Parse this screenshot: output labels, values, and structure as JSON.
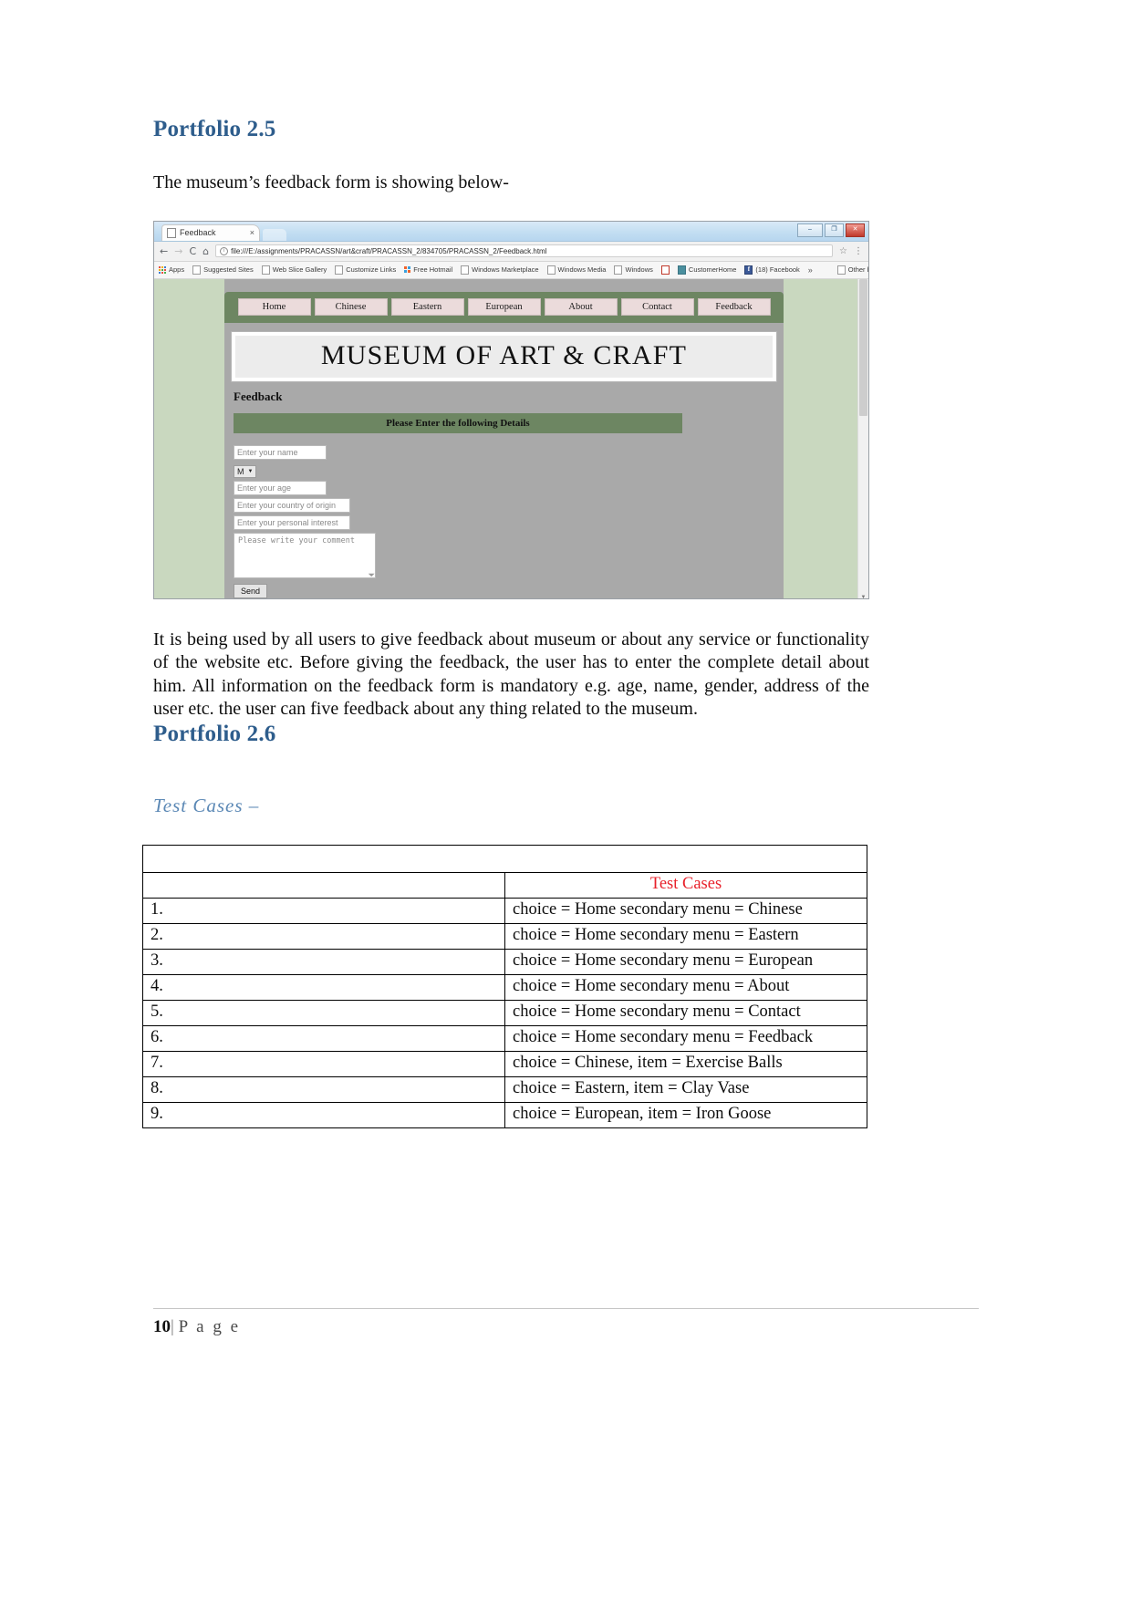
{
  "document": {
    "section_2_5": {
      "heading": "Portfolio 2.5",
      "intro": "The museum’s feedback form is showing below-",
      "description": "It is being used by all users to give feedback about museum or about any service or functionality of the website etc. Before giving the feedback, the user has to enter the complete detail about him. All information on the feedback form is mandatory e.g. age, name, gender, address of the user etc. the user can five feedback about any thing related to the museum."
    },
    "section_2_6": {
      "heading": "Portfolio 2.6",
      "subheading": "Test Cases –"
    },
    "footer": {
      "page_number": "10",
      "separator": "|",
      "word": "P a g e"
    }
  },
  "browser": {
    "tab": {
      "title": "Feedback",
      "close_label": "×"
    },
    "window_controls": {
      "minimize": "–",
      "restore": "❐",
      "close": "✕"
    },
    "toolbar": {
      "back": "←",
      "forward": "→",
      "reload": "C",
      "home": "⌂",
      "url": "file:///E:/assignments/PRACASSN/art&craft/PRACASSN_2/834705/PRACASSN_2/Feedback.html",
      "info_glyph": "i",
      "star": "☆",
      "menu": "⋮"
    },
    "bookmarks": [
      {
        "label": "Apps",
        "icon": "apps-grid-icon"
      },
      {
        "label": "Suggested Sites",
        "icon": "page-icon"
      },
      {
        "label": "Web Slice Gallery",
        "icon": "page-icon"
      },
      {
        "label": "Customize Links",
        "icon": "page-icon"
      },
      {
        "label": "Free Hotmail",
        "icon": "windows-logo-icon"
      },
      {
        "label": "Windows Marketplace",
        "icon": "page-icon"
      },
      {
        "label": "Windows Media",
        "icon": "page-icon"
      },
      {
        "label": "Windows",
        "icon": "page-icon"
      },
      {
        "label": "",
        "icon": "red-bookmark-icon"
      },
      {
        "label": "CustomerHome",
        "icon": "teal-icon"
      },
      {
        "label": "(18) Facebook",
        "icon": "facebook-icon"
      }
    ],
    "bookmarks_overflow": "»",
    "other_bookmarks": "Other bookmarks"
  },
  "site": {
    "nav": [
      "Home",
      "Chinese",
      "Eastern",
      "European",
      "About",
      "Contact",
      "Feedback"
    ],
    "banner": "MUSEUM OF ART & CRAFT",
    "page_heading": "Feedback",
    "details_bar": "Please Enter the following Details",
    "form": {
      "name_placeholder": "Enter your name",
      "gender_value": "M",
      "gender_caret": "▼",
      "age_placeholder": "Enter your age",
      "country_placeholder": "Enter your country of origin",
      "interest_placeholder": "Enter your personal interest",
      "comment_placeholder": "Please write your comment",
      "send_label": "Send"
    }
  },
  "test_cases": {
    "header": "Test Cases",
    "rows": [
      {
        "no": "1.",
        "text": "choice = Home secondary menu = Chinese"
      },
      {
        "no": "2.",
        "text": "choice = Home secondary menu = Eastern"
      },
      {
        "no": "3.",
        "text": "choice = Home secondary menu = European"
      },
      {
        "no": "4.",
        "text": "choice = Home secondary menu = About"
      },
      {
        "no": "5.",
        "text": "choice = Home secondary menu = Contact"
      },
      {
        "no": "6.",
        "text": "choice = Home secondary menu = Feedback"
      },
      {
        "no": "7.",
        "text": "choice = Chinese, item = Exercise Balls"
      },
      {
        "no": "8.",
        "text": "choice = Eastern, item = Clay Vase"
      },
      {
        "no": "9.",
        "text": "choice = European, item = Iron Goose"
      }
    ]
  },
  "colors": {
    "heading_blue": "#2E5D8C",
    "subheading_blue": "#5b88b5",
    "table_header_red": "#e8202a",
    "site_green": "#6d8662",
    "site_page_bg": "#c9d8bf"
  }
}
